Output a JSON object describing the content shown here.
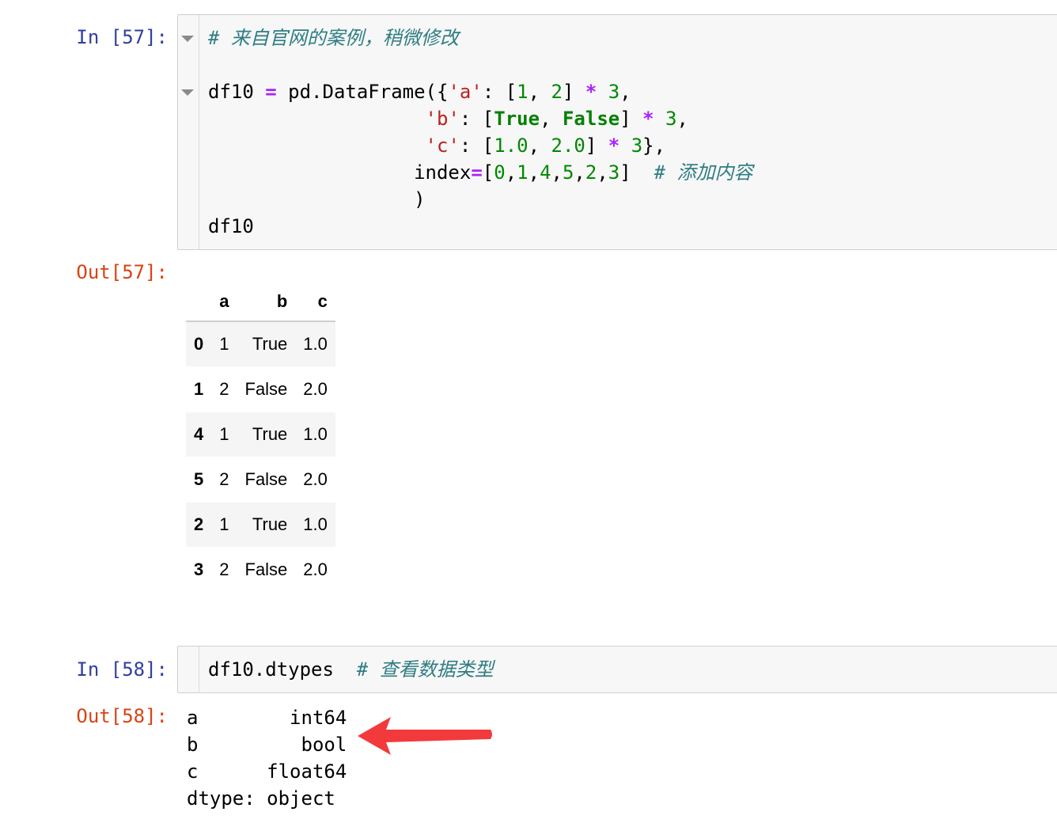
{
  "cells": [
    {
      "in_prompt": "In [57]:",
      "out_prompt": "Out[57]:",
      "code_lines": [
        [
          {
            "c": "cm",
            "t": "# 来自官网的案例，稍微修改"
          }
        ],
        [],
        [
          {
            "c": "",
            "t": "df10 "
          },
          {
            "c": "op",
            "t": "="
          },
          {
            "c": "",
            "t": " pd.DataFrame({"
          },
          {
            "c": "str",
            "t": "'a'"
          },
          {
            "c": "",
            "t": ": ["
          },
          {
            "c": "num",
            "t": "1"
          },
          {
            "c": "",
            "t": ", "
          },
          {
            "c": "num",
            "t": "2"
          },
          {
            "c": "",
            "t": "] "
          },
          {
            "c": "op",
            "t": "*"
          },
          {
            "c": "",
            "t": " "
          },
          {
            "c": "num",
            "t": "3"
          },
          {
            "c": "",
            "t": ","
          }
        ],
        [
          {
            "c": "",
            "t": "                   "
          },
          {
            "c": "str",
            "t": "'b'"
          },
          {
            "c": "",
            "t": ": ["
          },
          {
            "c": "kw",
            "t": "True"
          },
          {
            "c": "",
            "t": ", "
          },
          {
            "c": "kw",
            "t": "False"
          },
          {
            "c": "",
            "t": "] "
          },
          {
            "c": "op",
            "t": "*"
          },
          {
            "c": "",
            "t": " "
          },
          {
            "c": "num",
            "t": "3"
          },
          {
            "c": "",
            "t": ","
          }
        ],
        [
          {
            "c": "",
            "t": "                   "
          },
          {
            "c": "str",
            "t": "'c'"
          },
          {
            "c": "",
            "t": ": ["
          },
          {
            "c": "num",
            "t": "1.0"
          },
          {
            "c": "",
            "t": ", "
          },
          {
            "c": "num",
            "t": "2.0"
          },
          {
            "c": "",
            "t": "] "
          },
          {
            "c": "op",
            "t": "*"
          },
          {
            "c": "",
            "t": " "
          },
          {
            "c": "num",
            "t": "3"
          },
          {
            "c": "",
            "t": "},"
          }
        ],
        [
          {
            "c": "",
            "t": "                  index"
          },
          {
            "c": "op",
            "t": "="
          },
          {
            "c": "",
            "t": "["
          },
          {
            "c": "num",
            "t": "0"
          },
          {
            "c": "",
            "t": ","
          },
          {
            "c": "num",
            "t": "1"
          },
          {
            "c": "",
            "t": ","
          },
          {
            "c": "num",
            "t": "4"
          },
          {
            "c": "",
            "t": ","
          },
          {
            "c": "num",
            "t": "5"
          },
          {
            "c": "",
            "t": ","
          },
          {
            "c": "num",
            "t": "2"
          },
          {
            "c": "",
            "t": ","
          },
          {
            "c": "num",
            "t": "3"
          },
          {
            "c": "",
            "t": "]  "
          },
          {
            "c": "cm",
            "t": "# 添加内容"
          }
        ],
        [
          {
            "c": "",
            "t": "                  )"
          }
        ],
        [
          {
            "c": "",
            "t": "df10"
          }
        ]
      ],
      "table": {
        "columns": [
          "",
          "a",
          "b",
          "c"
        ],
        "rows": [
          [
            "0",
            "1",
            "True",
            "1.0"
          ],
          [
            "1",
            "2",
            "False",
            "2.0"
          ],
          [
            "4",
            "1",
            "True",
            "1.0"
          ],
          [
            "5",
            "2",
            "False",
            "2.0"
          ],
          [
            "2",
            "1",
            "True",
            "1.0"
          ],
          [
            "3",
            "2",
            "False",
            "2.0"
          ]
        ]
      }
    },
    {
      "in_prompt": "In [58]:",
      "out_prompt": "Out[58]:",
      "code_lines": [
        [
          {
            "c": "",
            "t": "df10.dtypes  "
          },
          {
            "c": "cm",
            "t": "# 查看数据类型"
          }
        ]
      ],
      "output_text": "a        int64\nb         bool\nc      float64\ndtype: object"
    }
  ],
  "colors": {
    "in_prompt": "#303f9f",
    "out_prompt": "#d84315",
    "arrow": "#f23a3c"
  }
}
